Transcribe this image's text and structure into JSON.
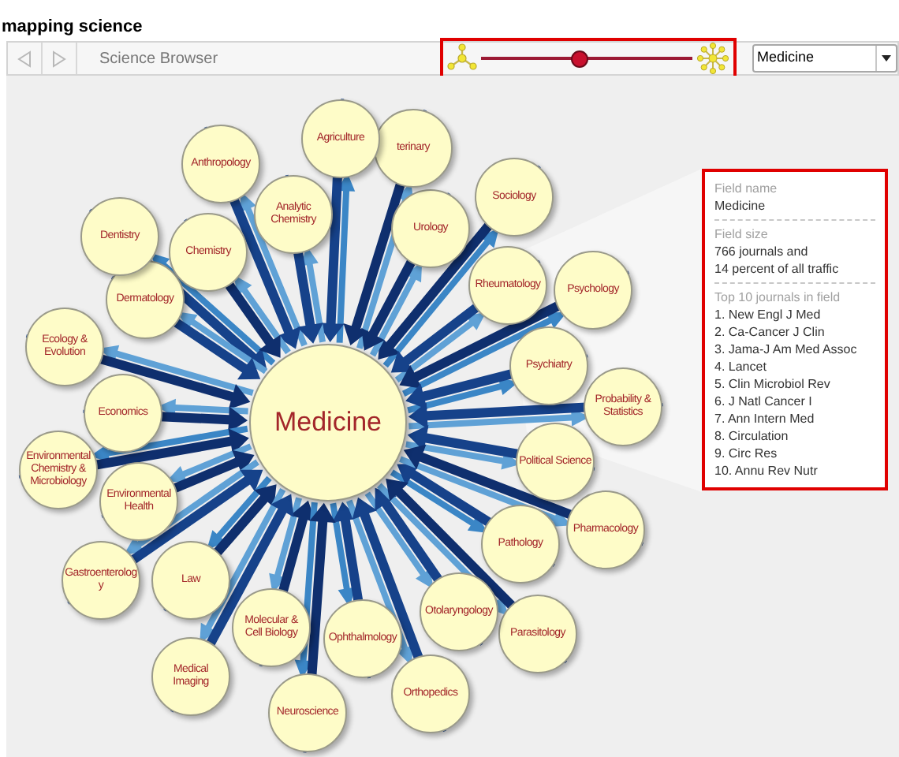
{
  "header": {
    "title": "mapping science"
  },
  "toolbar": {
    "back_disabled": true,
    "forward_disabled": true,
    "title": "Science Browser",
    "slider": {
      "level": 0.47
    },
    "field_select": {
      "value": "Medicine"
    }
  },
  "map": {
    "center": "Medicine",
    "nodes": [
      {
        "label": "Agriculture"
      },
      {
        "label": "terinary"
      },
      {
        "label": "Anthropology"
      },
      {
        "label": "Sociology"
      },
      {
        "label": "Analytic Chemistry"
      },
      {
        "label": "Urology"
      },
      {
        "label": "Dentistry"
      },
      {
        "label": "Chemistry"
      },
      {
        "label": "Rheumatology"
      },
      {
        "label": "Psychology"
      },
      {
        "label": "Dermatology"
      },
      {
        "label": "Ecology & Evolution"
      },
      {
        "label": "Psychiatry"
      },
      {
        "label": "Economics"
      },
      {
        "label": "Probability & Statistics"
      },
      {
        "label": "Environmental Chemistry & Microbiology"
      },
      {
        "label": "Political Science"
      },
      {
        "label": "Environmental Health"
      },
      {
        "label": "Pathology"
      },
      {
        "label": "Pharmacology"
      },
      {
        "label": "Gastroenterology"
      },
      {
        "label": "Law"
      },
      {
        "label": "Otolaryngology"
      },
      {
        "label": "Molecular & Cell Biology"
      },
      {
        "label": "Ophthalmology"
      },
      {
        "label": "Parasitology"
      },
      {
        "label": "Medical Imaging"
      },
      {
        "label": "Neuroscience"
      },
      {
        "label": "Orthopedics"
      }
    ]
  },
  "info_panel": {
    "sections": [
      {
        "heading": "Field name",
        "lines": [
          "Medicine"
        ]
      },
      {
        "heading": "Field size",
        "lines": [
          "766 journals and",
          "14 percent of all traffic"
        ]
      },
      {
        "heading": "Top 10 journals in field",
        "lines": [
          "1. New Engl J Med",
          "2. Ca-Cancer J Clin",
          "3. Jama-J Am Med Assoc",
          "4. Lancet",
          "5. Clin Microbiol Rev",
          "6. J Natl Cancer I",
          "7. Ann Intern Med",
          "8. Circulation",
          "9. Circ Res",
          "10. Annu Rev Nutr"
        ]
      }
    ]
  }
}
